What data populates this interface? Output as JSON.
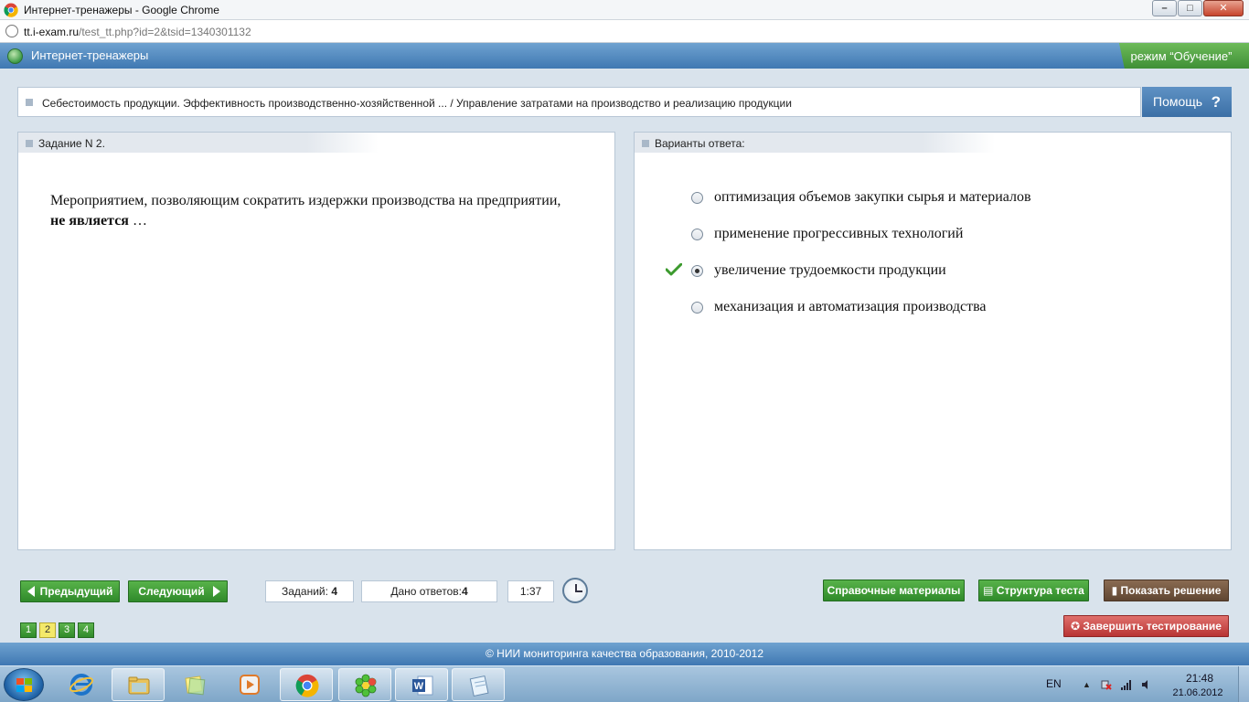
{
  "window": {
    "title": "Интернет-тренажеры - Google Chrome",
    "controls": {
      "minimize": "–",
      "maximize": "□",
      "close": "✕"
    }
  },
  "address": {
    "host": "tt.i-exam.ru",
    "path": "/test_tt.php?id=2&tsid=1340301132"
  },
  "app": {
    "title": "Интернет-тренажеры",
    "mode": "режим “Обучение”"
  },
  "breadcrumb": {
    "text": "Себестоимость продукции. Эффективность производственно-хозяйственной ... / Управление затратами на производство и реализацию продукции",
    "help_label": "Помощь",
    "help_icon": "?"
  },
  "task": {
    "header": "Задание N 2.",
    "question_start": "Мероприятием, позволяющим сократить издержки производства на предприятии, ",
    "question_bold": "не является",
    "question_end": " …"
  },
  "answers": {
    "header": "Варианты ответа:",
    "options": [
      {
        "text": "оптимизация объемов закупки сырья и материалов",
        "selected": false
      },
      {
        "text": "применение прогрессивных технологий",
        "selected": false
      },
      {
        "text": "увеличение трудоемкости продукции",
        "selected": true
      },
      {
        "text": "механизация и автоматизация производства",
        "selected": false
      }
    ]
  },
  "controls": {
    "prev_label": "Предыдущий",
    "next_label": "Следующий",
    "tasks_label": "Заданий: ",
    "tasks_count": "4",
    "answers_label": "Дано ответов:",
    "answers_count": "4",
    "timer": "1:37",
    "reference_label": "Справочные материалы",
    "structure_label": "Структура теста",
    "solution_label": "Показать решение",
    "finish_label": "Завершить тестирование",
    "pages": [
      "1",
      "2",
      "3",
      "4"
    ],
    "active_page": "2"
  },
  "footer": {
    "text": "© НИИ мониторинга качества образования, 2010-2012"
  },
  "taskbar": {
    "lang": "EN",
    "time": "21:48",
    "date": "21.06.2012"
  },
  "colors": {
    "accent_blue": "#3f78b2",
    "button_green": "#2f8a2a",
    "mode_green": "#3f8f36",
    "finish_red": "#b83434",
    "solution_brown": "#5f4632",
    "active_page_yellow": "#f4e96a"
  }
}
